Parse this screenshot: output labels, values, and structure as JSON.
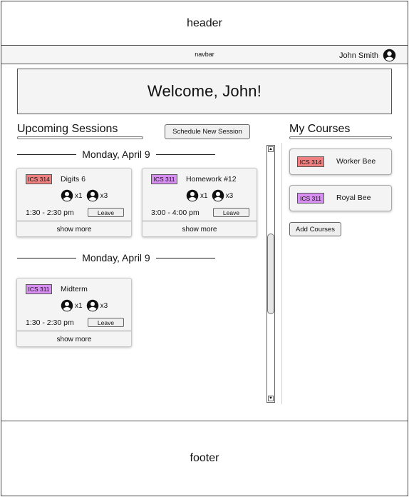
{
  "header": {
    "label": "header"
  },
  "navbar": {
    "label": "navbar",
    "user_name": "John Smith",
    "user_icon": "account-circle-icon"
  },
  "welcome": {
    "text": "Welcome, John!"
  },
  "upcoming": {
    "title": "Upcoming Sessions",
    "schedule_button": "Schedule New Session",
    "days": [
      {
        "label": "Monday, April 9",
        "sessions": [
          {
            "course": "ICS 314",
            "course_color": "#f08080",
            "title": "Digits 6",
            "count_a": "x1",
            "count_b": "x3",
            "time": "1:30 - 2:30 pm",
            "leave": "Leave",
            "more": "show more"
          },
          {
            "course": "ICS 311",
            "course_color": "#d88ef2",
            "title": "Homework #12",
            "count_a": "x1",
            "count_b": "x3",
            "time": "3:00 - 4:00 pm",
            "leave": "Leave",
            "more": "show more"
          }
        ]
      },
      {
        "label": "Monday, April 9",
        "sessions": [
          {
            "course": "ICS 311",
            "course_color": "#d88ef2",
            "title": "Midterm",
            "count_a": "x1",
            "count_b": "x3",
            "time": "1:30 - 2:30 pm",
            "leave": "Leave",
            "more": "show more"
          }
        ]
      }
    ]
  },
  "courses": {
    "title": "My Courses",
    "items": [
      {
        "code": "ICS 314",
        "color": "#f08080",
        "name": "Worker Bee"
      },
      {
        "code": "ICS 311",
        "color": "#d88ef2",
        "name": "Royal Bee"
      }
    ],
    "add_button": "Add Courses"
  },
  "footer": {
    "label": "footer"
  }
}
